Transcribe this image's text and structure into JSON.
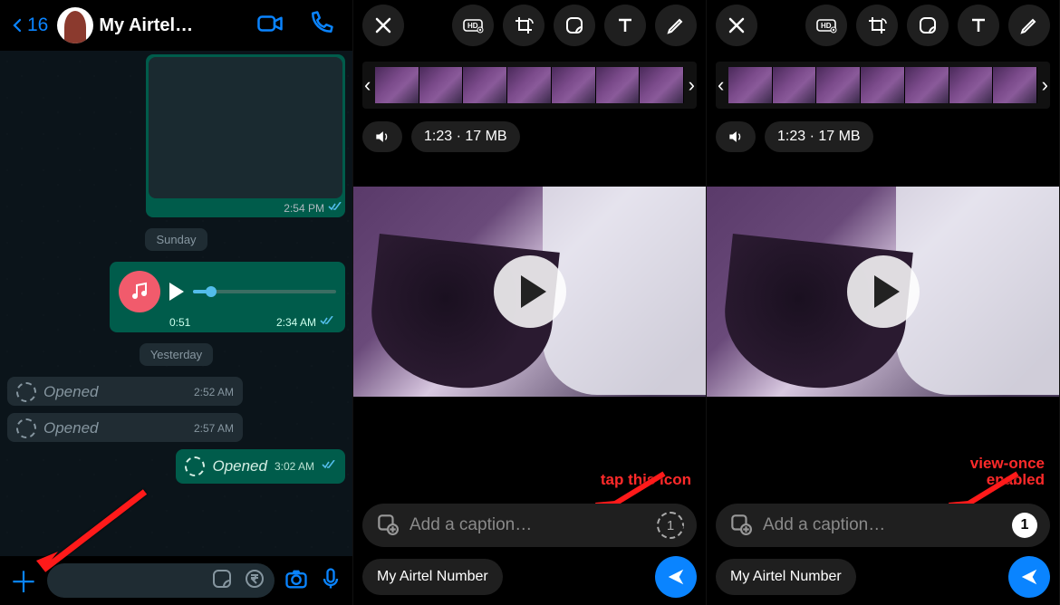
{
  "chat": {
    "back_count": "16",
    "title": "My Airtel…",
    "image_time": "2:54 PM",
    "date1": "Sunday",
    "date2": "Yesterday",
    "audio": {
      "duration": "0:51",
      "time": "2:34 AM"
    },
    "opened1": {
      "label": "Opened",
      "time": "2:52 AM"
    },
    "opened2": {
      "label": "Opened",
      "time": "2:57 AM"
    },
    "opened3": {
      "label": "Opened",
      "time": "3:02 AM"
    }
  },
  "editor": {
    "video_meta": "1:23 · 17 MB",
    "caption_placeholder": "Add a caption…",
    "recipient": "My Airtel Number",
    "view_once_digit": "1"
  },
  "annotations": {
    "panel2": "tap this icon",
    "panel3_line1": "view-once",
    "panel3_line2": "enabled"
  }
}
